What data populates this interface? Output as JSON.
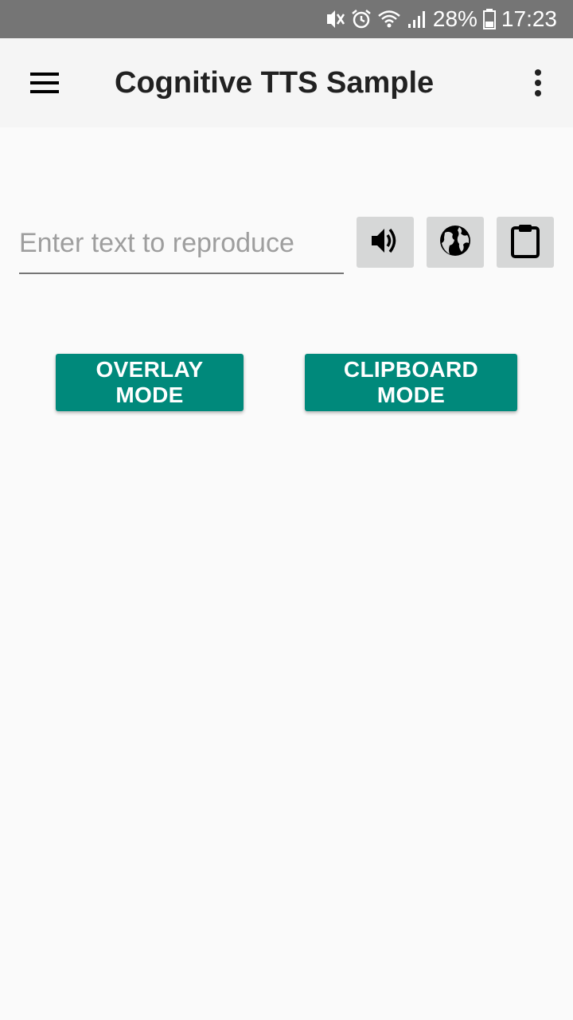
{
  "status_bar": {
    "battery": "28%",
    "time": "17:23",
    "icons": [
      "mute-vibrate-icon",
      "alarm-icon",
      "wifi-icon",
      "signal-icon",
      "battery-icon"
    ]
  },
  "app_bar": {
    "title": "Cognitive TTS Sample",
    "menu_icon": "hamburger-menu-icon",
    "overflow_icon": "more-vert-icon"
  },
  "input": {
    "placeholder": "Enter text to reproduce",
    "value": ""
  },
  "action_icons": [
    "volume-up-icon",
    "globe-icon",
    "clipboard-icon"
  ],
  "buttons": {
    "overlay": "OVERLAY MODE",
    "clipboard": "CLIPBOARD MODE"
  },
  "colors": {
    "accent": "#00897b",
    "status_bar": "#757575",
    "app_bar": "#f5f5f5",
    "background": "#fafafa",
    "icon_button_bg": "#d6d7d7"
  }
}
